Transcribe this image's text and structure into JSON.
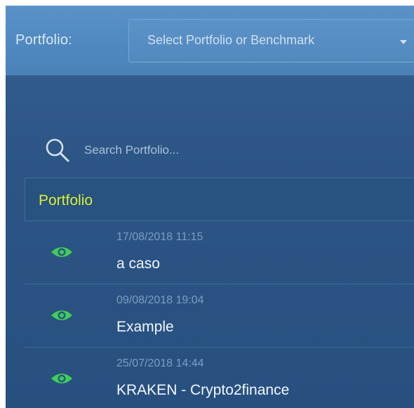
{
  "header": {
    "portfolio_label": "Portfolio:",
    "select_placeholder": "Select Portfolio or Benchmark"
  },
  "search": {
    "placeholder": "Search Portfolio..."
  },
  "section": {
    "title": "Portfolio"
  },
  "portfolios": [
    {
      "date": "17/08/2018 11:15",
      "name": "a caso",
      "icon": "eye-icon"
    },
    {
      "date": "09/08/2018 19:04",
      "name": "Example",
      "icon": "eye-icon"
    },
    {
      "date": "25/07/2018 14:44",
      "name": "KRAKEN - Crypto2finance",
      "icon": "eye-icon"
    }
  ],
  "colors": {
    "accent_yellow": "#d8ef33",
    "eye_green": "#3fcf55",
    "topbar": "#4f88bf",
    "panel": "#2c5585"
  }
}
